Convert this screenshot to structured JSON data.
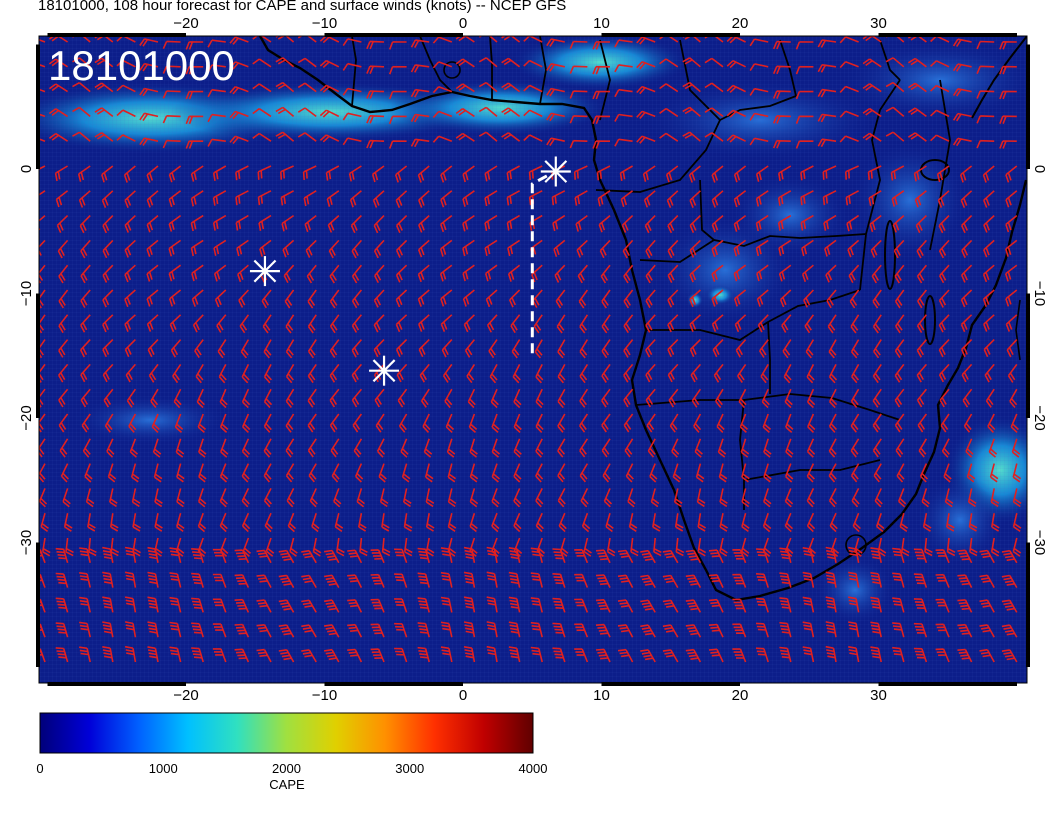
{
  "title": "18101000, 108 hour forecast for CAPE and surface winds (knots) -- NCEP GFS",
  "map_stamp": "18101000",
  "longitude_ticks": [
    "−20",
    "−10",
    "0",
    "10",
    "20",
    "30"
  ],
  "latitude_ticks": [
    "0",
    "−10",
    "−20",
    "−30"
  ],
  "colorbar": {
    "variable": "CAPE",
    "range": [
      0,
      4000
    ],
    "tick_labels": [
      "0",
      "1000",
      "2000",
      "3000",
      "4000"
    ],
    "colors": [
      "#00007a",
      "#0000d8",
      "#0060ff",
      "#00c0ff",
      "#30e0c0",
      "#a0e040",
      "#e0d000",
      "#ff9000",
      "#ff3000",
      "#c00000",
      "#600000"
    ]
  },
  "colors": {
    "ocean_background": "#0c1e8a",
    "wind_barbs": "#e02020",
    "coastline": "#000000",
    "track_markers": "#ffffff"
  },
  "markers": [
    {
      "symbol": "asterisk",
      "lon": -14.3,
      "lat": -8.2
    },
    {
      "symbol": "asterisk",
      "lon": -5.7,
      "lat": -16.2
    },
    {
      "symbol": "asterisk",
      "lon": 6.7,
      "lat": -0.2
    }
  ],
  "track_line": {
    "style": "dashed",
    "lon": [
      5.0,
      5.0,
      6.3
    ],
    "lat": [
      -14.8,
      -1.2,
      -0.4
    ]
  }
}
